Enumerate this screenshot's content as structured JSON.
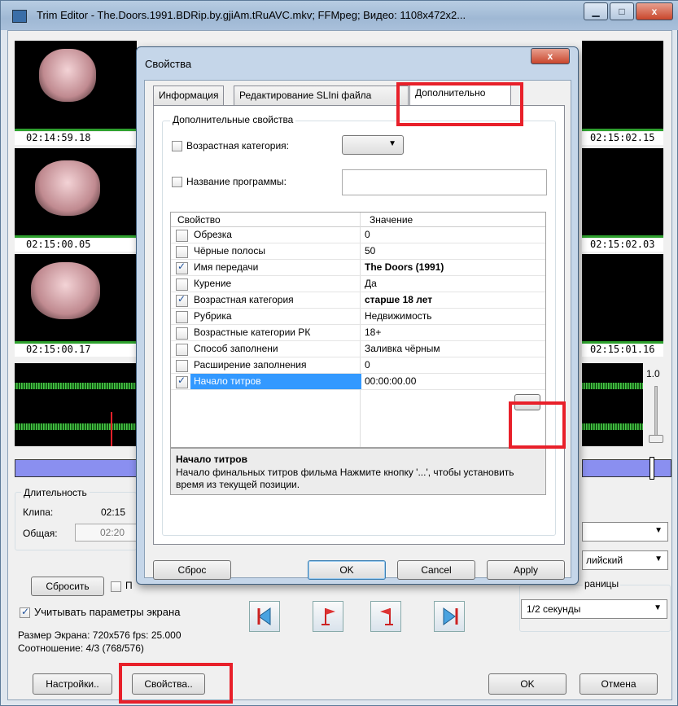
{
  "window": {
    "title": "Trim Editor - The.Doors.1991.BDRip.by.gjiAm.tRuAVC.mkv; FFMpeg; Видео: 1108x472x2...",
    "min_symbol": "▁",
    "max_symbol": "□",
    "close_symbol": "x"
  },
  "timecodes": {
    "left": [
      "02:14:59.18",
      "02:15:00.05",
      "02:15:00.17"
    ],
    "right": [
      "02:15:02.15",
      "02:15:02.03",
      "02:15:01.16"
    ]
  },
  "volume_label": "1.0",
  "duration": {
    "title": "Длительность",
    "clip_label": "Клипа:",
    "clip_value": "02:15",
    "total_label": "Общая:",
    "total_value": "02:20"
  },
  "right_panel": {
    "combo2_value": "лийский",
    "group_label": "раницы",
    "combo3_value": "1/2 секунды"
  },
  "bottom": {
    "reset_button": "Сбросить",
    "partial_checkbox": "П",
    "screen_params_checkbox": "Учитывать параметры экрана",
    "screen_info_1": "Размер Экрана: 720x576 fps: 25.000",
    "screen_info_2": "Соотношение: 4/3 (768/576)",
    "settings_button": "Настройки..",
    "properties_button": "Свойства..",
    "ok_button": "OK",
    "cancel_button": "Отмена"
  },
  "dialog": {
    "title": "Свойства",
    "close_symbol": "x",
    "tabs": [
      "Информация",
      "Редактирование SLIni файла",
      "Дополнительно"
    ],
    "group_title": "Дополнительные свойства",
    "age_checkbox": "Возрастная категория:",
    "program_checkbox": "Название программы:",
    "grid_header": {
      "property": "Свойство",
      "value": "Значение"
    },
    "rows": [
      {
        "name": "Обрезка",
        "value": "0",
        "checked": false,
        "bold": false
      },
      {
        "name": "Чёрные полосы",
        "value": "50",
        "checked": false,
        "bold": false
      },
      {
        "name": "Имя передачи",
        "value": "The Doors (1991)",
        "checked": true,
        "bold": true
      },
      {
        "name": "Курение",
        "value": "Да",
        "checked": false,
        "bold": false
      },
      {
        "name": "Возрастная категория",
        "value": "старше 18 лет",
        "checked": true,
        "bold": true
      },
      {
        "name": "Рубрика",
        "value": "Недвижимость",
        "checked": false,
        "bold": false
      },
      {
        "name": "Возрастные категории РК",
        "value": "18+",
        "checked": false,
        "bold": false
      },
      {
        "name": "Способ заполнени",
        "value": "Заливка чёрным",
        "checked": false,
        "bold": false
      },
      {
        "name": "Расширение заполнения",
        "value": "0",
        "checked": false,
        "bold": false
      },
      {
        "name": "Начало титров",
        "value": "00:00:00.00",
        "checked": true,
        "bold": false
      }
    ],
    "ellipsis_button": "...",
    "desc_title": "Начало титров",
    "desc_text": "Начало финальных титров фильма Нажмите кнопку '...', чтобы установить время из текущей позиции.",
    "buttons": {
      "reset": "Сброс",
      "ok": "OK",
      "cancel": "Cancel",
      "apply": "Apply"
    }
  },
  "colors": {
    "highlight": "#e8202a",
    "selection": "#3399ff",
    "wave": "#2ea12e",
    "timeline": "#8a8ff0"
  }
}
